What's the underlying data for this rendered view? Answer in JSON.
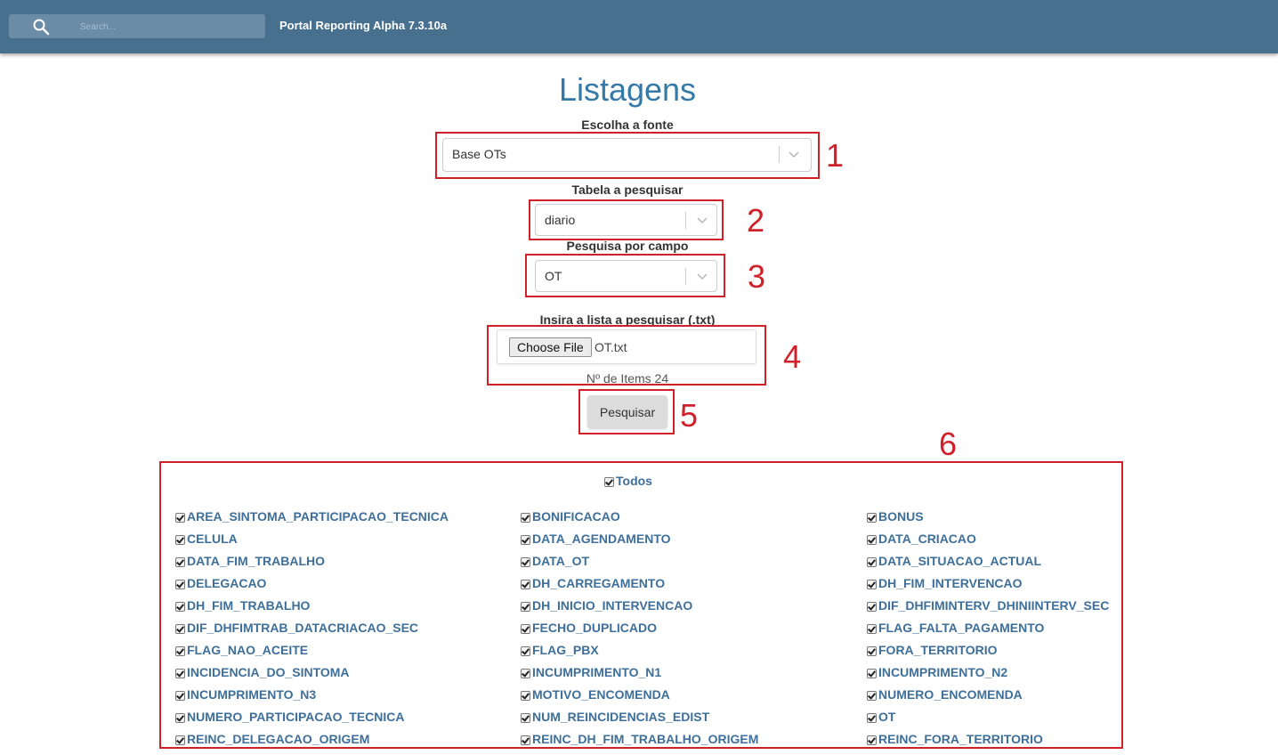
{
  "header": {
    "search_placeholder": "Search...",
    "app_title": "Portal Reporting Alpha 7.3.10a"
  },
  "page": {
    "title": "Listagens"
  },
  "source": {
    "label": "Escolha a fonte",
    "value": "Base OTs"
  },
  "table": {
    "label": "Tabela a pesquisar",
    "value": "diario"
  },
  "field_select": {
    "label": "Pesquisa por campo",
    "value": "OT"
  },
  "upload": {
    "label": "Insira a lista a pesquisar (.txt)",
    "button_label": "Choose File",
    "file_name": "OT.txt",
    "items_count": "Nº de Items 24"
  },
  "actions": {
    "search_label": "Pesquisar"
  },
  "annotations": [
    "1",
    "2",
    "3",
    "4",
    "5",
    "6"
  ],
  "checkboxes": {
    "all_label": "Todos",
    "all_checked": true,
    "columns": [
      [
        "AREA_SINTOMA_PARTICIPACAO_TECNICA",
        "CELULA",
        "DATA_FIM_TRABALHO",
        "DELEGACAO",
        "DH_FIM_TRABALHO",
        "DIF_DHFIMTRAB_DATACRIACAO_SEC",
        "FLAG_NAO_ACEITE",
        "INCIDENCIA_DO_SINTOMA",
        "INCUMPRIMENTO_N3",
        "NUMERO_PARTICIPACAO_TECNICA",
        "REINC_DELEGACAO_ORIGEM"
      ],
      [
        "BONIFICACAO",
        "DATA_AGENDAMENTO",
        "DATA_OT",
        "DH_CARREGAMENTO",
        "DH_INICIO_INTERVENCAO",
        "FECHO_DUPLICADO",
        "FLAG_PBX",
        "INCUMPRIMENTO_N1",
        "MOTIVO_ENCOMENDA",
        "NUM_REINCIDENCIAS_EDIST",
        "REINC_DH_FIM_TRABALHO_ORIGEM"
      ],
      [
        "BONUS",
        "DATA_CRIACAO",
        "DATA_SITUACAO_ACTUAL",
        "DH_FIM_INTERVENCAO",
        "DIF_DHFIMINTERV_DHINIINTERV_SEC",
        "FLAG_FALTA_PAGAMENTO",
        "FORA_TERRITORIO",
        "INCUMPRIMENTO_N2",
        "NUMERO_ENCOMENDA",
        "OT",
        "REINC_FORA_TERRITORIO"
      ]
    ]
  },
  "colors": {
    "header_bg": "#47708f",
    "title": "#3479a8",
    "annotation_red": "#d0202a",
    "field_text": "#3e6f9a"
  }
}
